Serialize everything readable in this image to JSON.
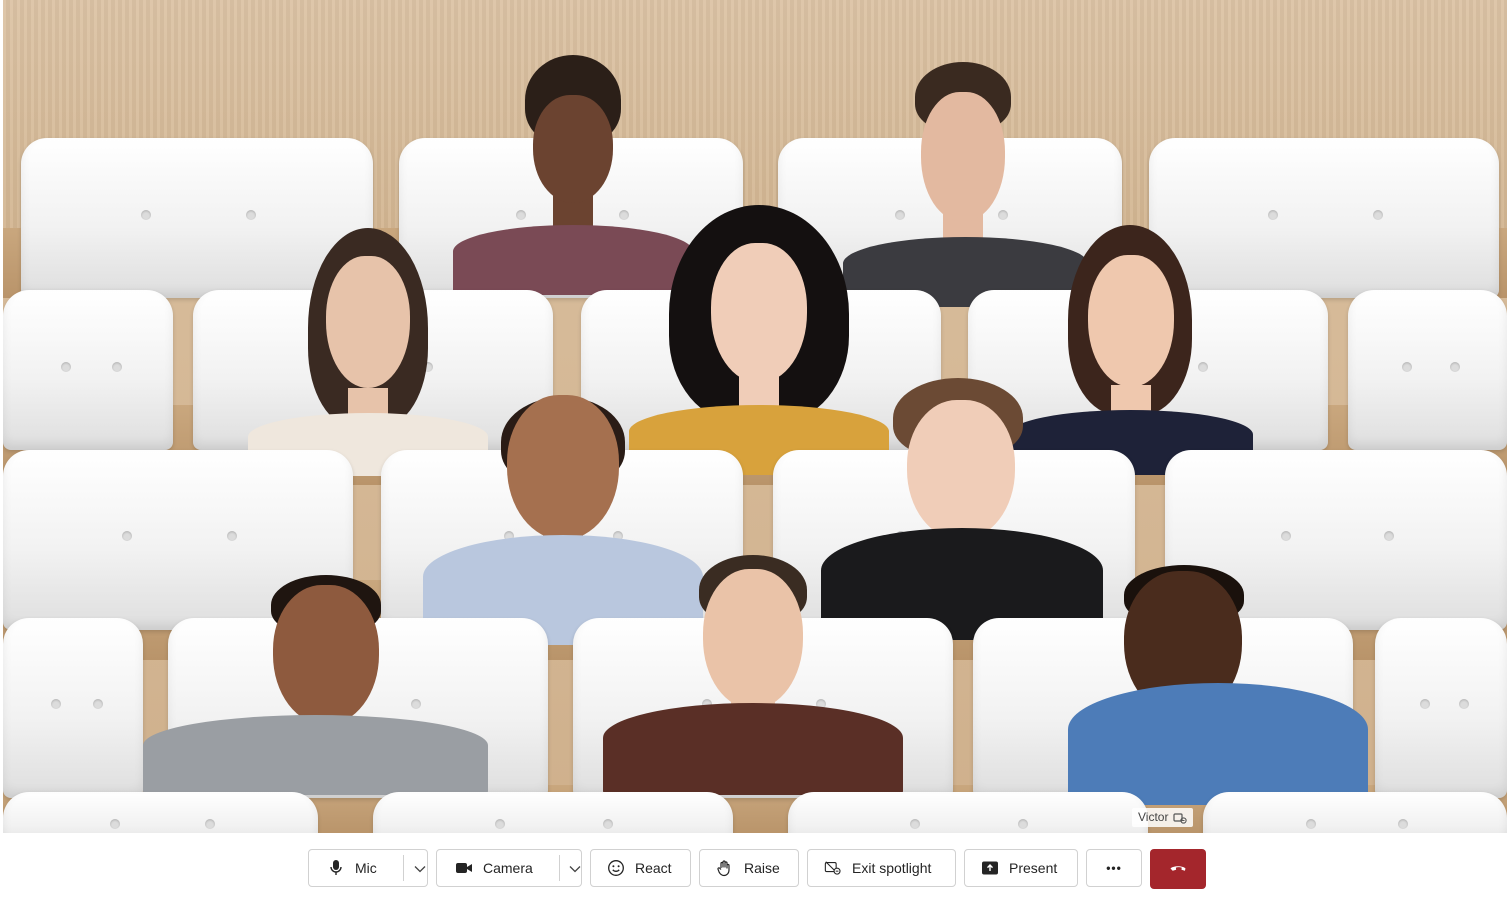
{
  "scene": {
    "mode": "Together mode",
    "participants": [
      {
        "row": 1,
        "seat": 1,
        "skin": "#6b4330",
        "hair": "#2b1f18",
        "shirt": "#7a4a55"
      },
      {
        "row": 1,
        "seat": 2,
        "skin": "#e3b9a0",
        "hair": "#3a2a20",
        "shirt": "#3b3b40"
      },
      {
        "row": 2,
        "seat": 1,
        "skin": "#e7c3aa",
        "hair": "#3a2a22",
        "shirt": "#efe7dd"
      },
      {
        "row": 2,
        "seat": 2,
        "skin": "#f0cdb8",
        "hair": "#141010",
        "shirt": "#d8a23c"
      },
      {
        "row": 2,
        "seat": 3,
        "skin": "#efc8ae",
        "hair": "#3c251c",
        "shirt": "#1e2238"
      },
      {
        "row": 3,
        "seat": 1,
        "skin": "#a5704f",
        "hair": "#2a1c16",
        "shirt": "#b9c7de"
      },
      {
        "row": 3,
        "seat": 2,
        "skin": "#f0cdb8",
        "hair": "#6b4a34",
        "shirt": "#1a1a1c"
      },
      {
        "row": 4,
        "seat": 1,
        "skin": "#8e5a3e",
        "hair": "#1f1510",
        "shirt": "#9a9ea3"
      },
      {
        "row": 4,
        "seat": 2,
        "skin": "#eac3a8",
        "hair": "#3a2c22",
        "shirt": "#5a2f26"
      },
      {
        "row": 4,
        "seat": 3,
        "skin": "#4a2c1d",
        "hair": "#1a110c",
        "shirt": "#4d7cb8"
      }
    ],
    "name_tag": {
      "name": "Victor",
      "icon": "pinned-video-icon"
    }
  },
  "toolbar": {
    "mic": {
      "label": "Mic",
      "icon": "microphone-icon"
    },
    "camera": {
      "label": "Camera",
      "icon": "video-camera-icon"
    },
    "react": {
      "label": "React",
      "icon": "smiley-icon"
    },
    "raise": {
      "label": "Raise",
      "icon": "hand-icon"
    },
    "exit_spotlight": {
      "label": "Exit spotlight",
      "icon": "exit-spotlight-icon"
    },
    "present": {
      "label": "Present",
      "icon": "share-screen-icon"
    },
    "more": {
      "label": "•••",
      "icon": "more-icon"
    },
    "leave": {
      "icon": "hang-up-icon",
      "color": "#a4262c"
    }
  }
}
